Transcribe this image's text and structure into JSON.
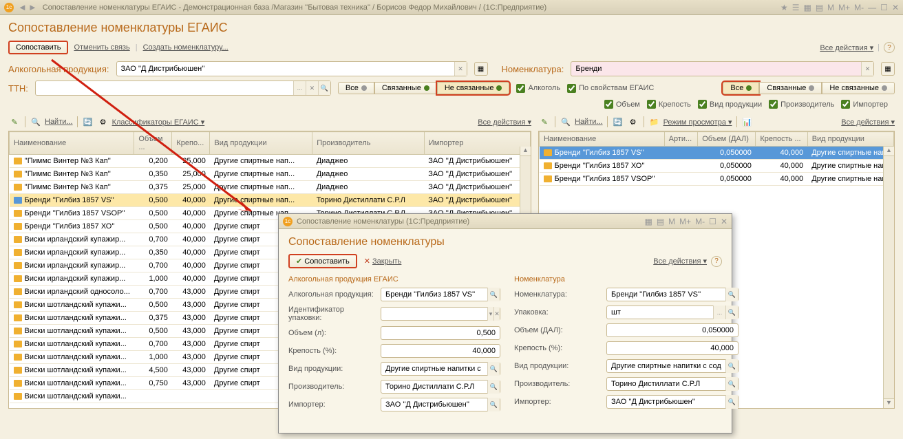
{
  "titlebar": {
    "title": "Сопоставление номенклатуры ЕГАИС - Демонстрационная база /Магазин ''Бытовая техника'' / Борисов Федор Михайлович /  (1С:Предприятие)",
    "m_buttons": [
      "M",
      "M+",
      "M-"
    ]
  },
  "page": {
    "title": "Сопоставление номенклатуры ЕГАИС"
  },
  "toolbar": {
    "match": "Сопоставить",
    "unlink": "Отменить связь",
    "create": "Создать номенклатуру...",
    "all_actions": "Все действия"
  },
  "filters": {
    "alc_label": "Алкогольная продукция:",
    "alc_value": "ЗАО ''Д Дистрибьюшен''",
    "nom_label": "Номенклатура:",
    "nom_value": "Бренди",
    "ttn_label": "ТТН:",
    "ttn_value": "",
    "all": "Все",
    "linked": "Связанные",
    "unlinked": "Не связанные",
    "alcohol_cb": "Алкоголь",
    "by_egais": "По свойствам ЕГАИС",
    "volume": "Объем",
    "strength": "Крепость",
    "prodtype": "Вид продукции",
    "producer": "Производитель",
    "importer": "Импортер"
  },
  "pane": {
    "find": "Найти...",
    "classifier": "Классификаторы ЕГАИС",
    "view_mode": "Режим просмотра",
    "all_actions": "Все действия"
  },
  "left_cols": [
    "Наименование",
    "Объем ...",
    "Крепо...",
    "Вид продукции",
    "Производитель",
    "Импортер"
  ],
  "left_rows": [
    {
      "n": "''Пиммс Винтер №3 Кап''",
      "v": "0,200",
      "k": "25,000",
      "t": "Другие спиртные нап...",
      "p": "Диаджео",
      "i": "ЗАО ''Д Дистрибьюшен''"
    },
    {
      "n": "''Пиммс Винтер №3 Кап''",
      "v": "0,350",
      "k": "25,000",
      "t": "Другие спиртные нап...",
      "p": "Диаджео",
      "i": "ЗАО ''Д Дистрибьюшен''"
    },
    {
      "n": "''Пиммс Винтер №3 Кап''",
      "v": "0,375",
      "k": "25,000",
      "t": "Другие спиртные нап...",
      "p": "Диаджео",
      "i": "ЗАО ''Д Дистрибьюшен''"
    },
    {
      "n": "Бренди ''Гилбиз 1857 VS''",
      "v": "0,500",
      "k": "40,000",
      "t": "Другие спиртные нап...",
      "p": "Торино Дистиллати С.Р.Л",
      "i": "ЗАО ''Д Дистрибьюшен''",
      "sel": true
    },
    {
      "n": "Бренди ''Гилбиз 1857 VSOP''",
      "v": "0,500",
      "k": "40,000",
      "t": "Другие спиртные нап...",
      "p": "Торино Дистиллати С.Р.Л",
      "i": "ЗАО ''Д Дистрибьюшен''"
    },
    {
      "n": "Бренди ''Гилбиз 1857 ХО''",
      "v": "0,500",
      "k": "40,000",
      "t": "Другие спирт",
      "p": "",
      "i": ""
    },
    {
      "n": "Виски ирландский купажир...",
      "v": "0,700",
      "k": "40,000",
      "t": "Другие спирт",
      "p": "",
      "i": ""
    },
    {
      "n": "Виски ирландский купажир...",
      "v": "0,350",
      "k": "40,000",
      "t": "Другие спирт",
      "p": "",
      "i": ""
    },
    {
      "n": "Виски ирландский купажир...",
      "v": "0,700",
      "k": "40,000",
      "t": "Другие спирт",
      "p": "",
      "i": ""
    },
    {
      "n": "Виски ирландский купажир...",
      "v": "1,000",
      "k": "40,000",
      "t": "Другие спирт",
      "p": "",
      "i": ""
    },
    {
      "n": "Виски ирландский односоло...",
      "v": "0,700",
      "k": "43,000",
      "t": "Другие спирт",
      "p": "",
      "i": ""
    },
    {
      "n": "Виски шотландский купажи...",
      "v": "0,500",
      "k": "43,000",
      "t": "Другие спирт",
      "p": "",
      "i": ""
    },
    {
      "n": "Виски шотландский купажи...",
      "v": "0,375",
      "k": "43,000",
      "t": "Другие спирт",
      "p": "",
      "i": ""
    },
    {
      "n": "Виски шотландский купажи...",
      "v": "0,500",
      "k": "43,000",
      "t": "Другие спирт",
      "p": "",
      "i": ""
    },
    {
      "n": "Виски шотландский купажи...",
      "v": "0,700",
      "k": "43,000",
      "t": "Другие спирт",
      "p": "",
      "i": ""
    },
    {
      "n": "Виски шотландский купажи...",
      "v": "1,000",
      "k": "43,000",
      "t": "Другие спирт",
      "p": "",
      "i": ""
    },
    {
      "n": "Виски шотландский купажи...",
      "v": "4,500",
      "k": "43,000",
      "t": "Другие спирт",
      "p": "",
      "i": ""
    },
    {
      "n": "Виски шотландский купажи...",
      "v": "0,750",
      "k": "43,000",
      "t": "Другие спирт",
      "p": "",
      "i": ""
    },
    {
      "n": "Виски шотландский купажи...",
      "v": "",
      "k": "",
      "t": "",
      "p": "",
      "i": ""
    }
  ],
  "right_cols": [
    "Наименование",
    "Арти...",
    "Объем (ДАЛ)",
    "Крепость ...",
    "Вид продукции"
  ],
  "right_rows": [
    {
      "n": "Бренди ''Гилбиз 1857 VS''",
      "a": "",
      "v": "0,050000",
      "k": "40,000",
      "t": "Другие спиртные нап",
      "sel": true
    },
    {
      "n": "Бренди ''Гилбиз 1857 ХО''",
      "a": "",
      "v": "0,050000",
      "k": "40,000",
      "t": "Другие спиртные нап"
    },
    {
      "n": "Бренди ''Гилбиз 1857 VSOP''",
      "a": "",
      "v": "0,050000",
      "k": "40,000",
      "t": "Другие спиртные нап"
    }
  ],
  "dialog": {
    "titlebar": "Сопоставление номенклатуры  (1С:Предприятие)",
    "title": "Сопоставление номенклатуры",
    "match": "Сопоставить",
    "close": "Закрыть",
    "all_actions": "Все действия",
    "left_section": "Алкогольная продукция ЕГАИС",
    "right_section": "Номенклатура",
    "left": {
      "alc_label": "Алкогольная продукция:",
      "alc_value": "Бренди ''Гилбиз 1857 VS''",
      "pack_id_label": "Идентификатор упаковки:",
      "pack_id_value": "",
      "vol_label": "Объем (л):",
      "vol_value": "0,500",
      "str_label": "Крепость (%):",
      "str_value": "40,000",
      "type_label": "Вид продукции:",
      "type_value": "Другие спиртные напитки с содерж",
      "prod_label": "Производитель:",
      "prod_value": "Торино Дистиллати С.Р.Л",
      "imp_label": "Импортер:",
      "imp_value": "ЗАО ''Д Дистрибьюшен''"
    },
    "right": {
      "nom_label": "Номенклатура:",
      "nom_value": "Бренди ''Гилбиз 1857 VS''",
      "pack_label": "Упаковка:",
      "pack_value": "шт",
      "vol_label": "Объем (ДАЛ):",
      "vol_value": "0,050000",
      "str_label": "Крепость (%):",
      "str_value": "40,000",
      "type_label": "Вид продукции:",
      "type_value": "Другие спиртные напитки с содерж",
      "prod_label": "Производитель:",
      "prod_value": "Торино Дистиллати С.Р.Л",
      "imp_label": "Импортер:",
      "imp_value": "ЗАО ''Д Дистрибьюшен''"
    }
  }
}
